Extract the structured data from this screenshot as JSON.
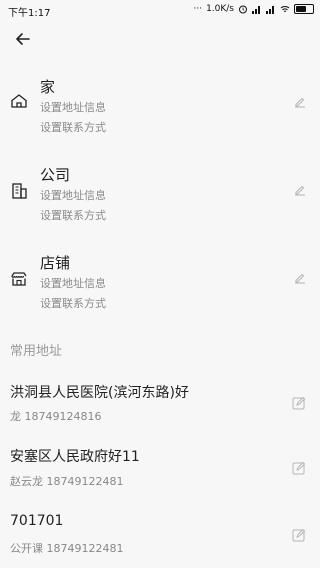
{
  "status": {
    "time": "下午1:17",
    "net_speed": "1.0K/s",
    "battery_icon": "battery-icon"
  },
  "header": {
    "back_icon": "back-arrow-icon"
  },
  "places": [
    {
      "title": "家",
      "line1": "设置地址信息",
      "line2": "设置联系方式",
      "icon": "home-icon"
    },
    {
      "title": "公司",
      "line1": "设置地址信息",
      "line2": "设置联系方式",
      "icon": "building-icon"
    },
    {
      "title": "店铺",
      "line1": "设置地址信息",
      "line2": "设置联系方式",
      "icon": "store-icon"
    }
  ],
  "common_section": {
    "title": "常用地址"
  },
  "addresses": [
    {
      "title": "洪洞县人民医院(滨河东路)好",
      "contact": "龙 18749124816"
    },
    {
      "title": "安塞区人民政府好11",
      "contact": "赵云龙 18749122481"
    },
    {
      "title": "701701",
      "contact": "公开课 18749122481"
    }
  ],
  "colors": {
    "background": "#f7f7f7",
    "primary_text": "#222222",
    "secondary_text": "#8a8a8a",
    "icon_gray": "#b5b5b5"
  }
}
